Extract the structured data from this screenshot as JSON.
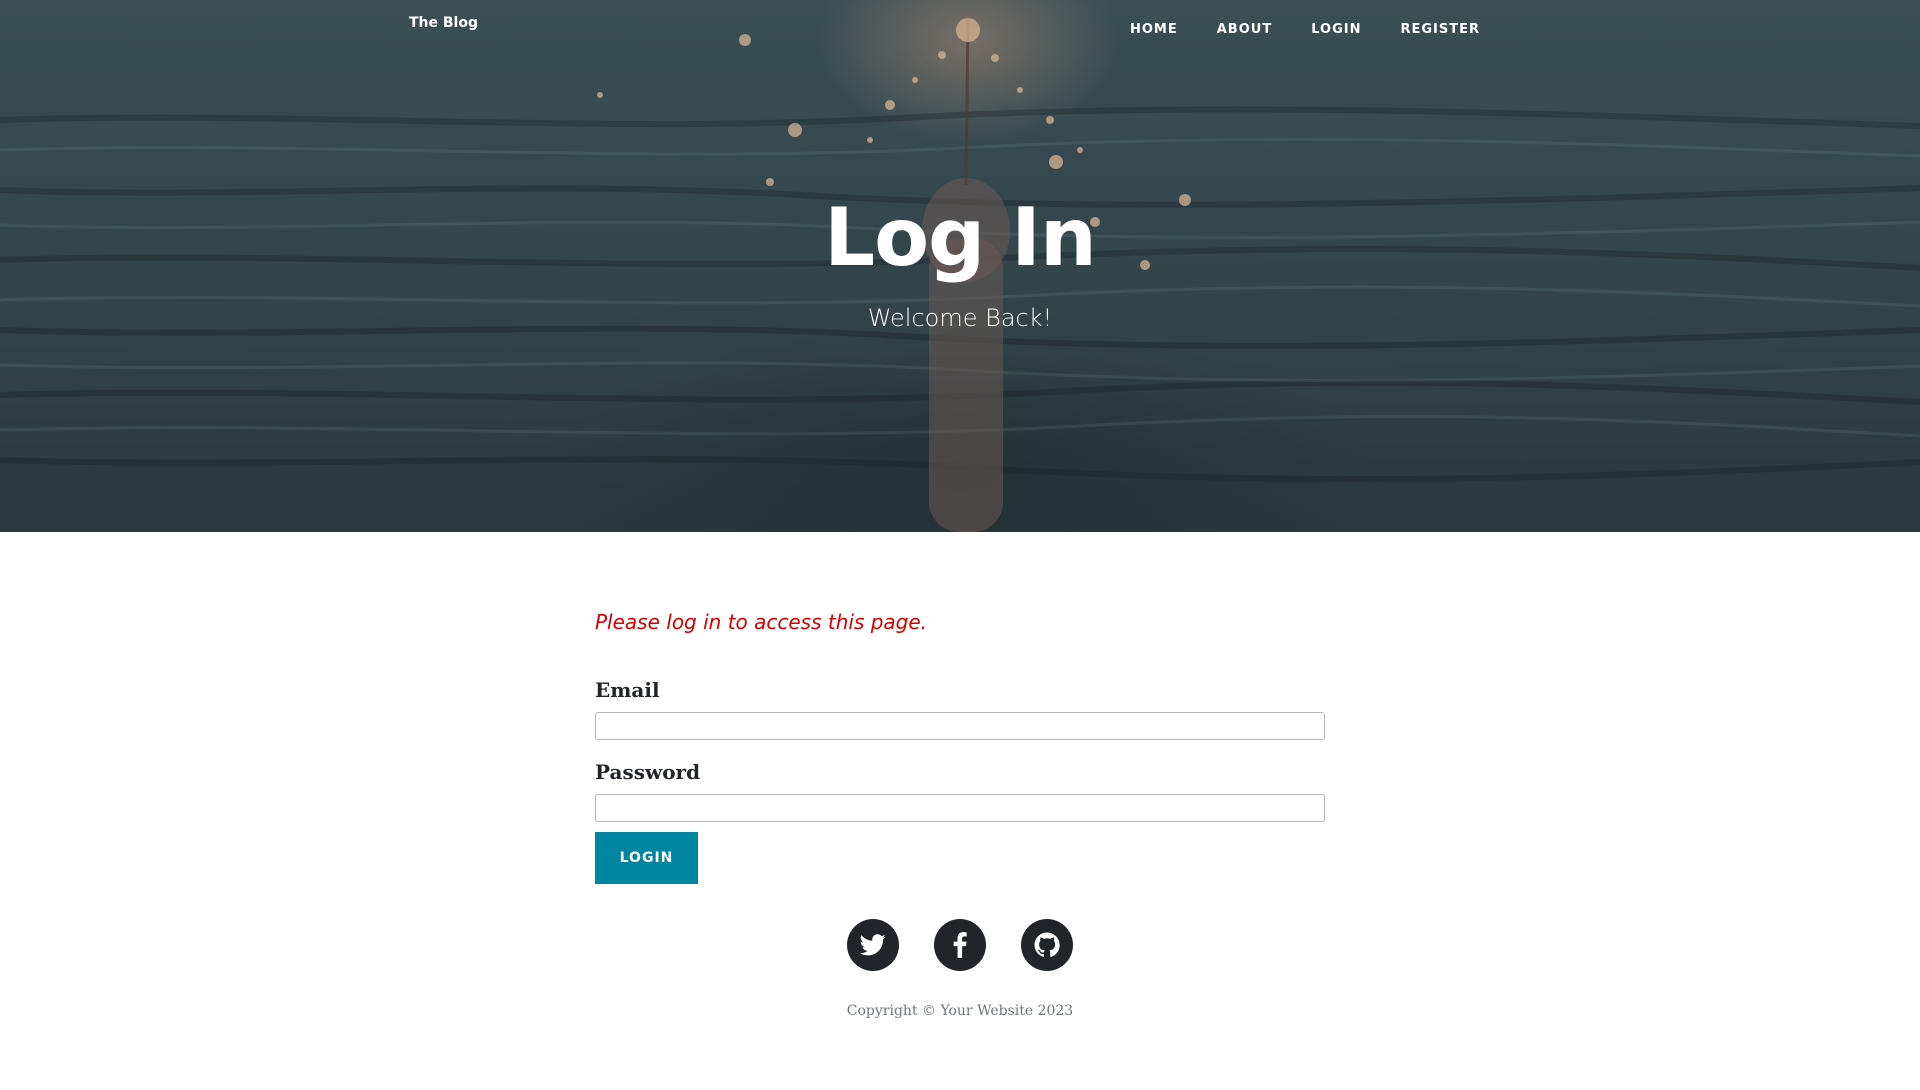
{
  "navbar": {
    "brand": "The Blog",
    "links": [
      "HOME",
      "ABOUT",
      "LOGIN",
      "REGISTER"
    ]
  },
  "hero": {
    "title": "Log In",
    "subtitle": "Welcome Back!"
  },
  "form": {
    "flash_message": "Please log in to access this page.",
    "email_label": "Email",
    "email_value": "",
    "password_label": "Password",
    "password_value": "",
    "submit_label": "LOGIN"
  },
  "footer": {
    "social_icons": [
      "twitter-icon",
      "facebook-icon",
      "github-icon"
    ],
    "copyright": "Copyright © Your Website 2023"
  },
  "colors": {
    "accent": "#0085a1",
    "flash": "#d40000",
    "icon_bg": "#212529"
  }
}
